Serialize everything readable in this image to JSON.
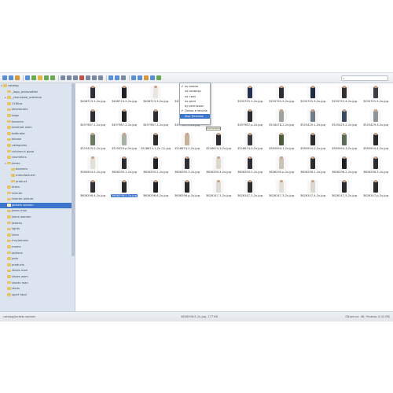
{
  "search": {
    "placeholder": ""
  },
  "toolbar": {
    "buttons": [
      "back",
      "forward",
      "up",
      "home",
      "reload",
      "folder",
      "upload",
      "download",
      "copy",
      "cut",
      "paste",
      "delete",
      "rename",
      "duplicate",
      "edit",
      "preview",
      "info",
      "resize",
      "view-icons",
      "view-list",
      "sort",
      "fullscreen",
      "settings"
    ]
  },
  "sidebar": {
    "items": [
      {
        "label": "catalog",
        "level": 0,
        "expanded": true
      },
      {
        "label": "_logo_proizvoditel",
        "level": 1
      },
      {
        "label": "_zhenskaia_odezhda",
        "level": 1,
        "collapsed": true
      },
      {
        "label": "3160sa",
        "level": 1
      },
      {
        "label": "aksessuars",
        "level": 1
      },
      {
        "label": "bags",
        "level": 1
      },
      {
        "label": "banners",
        "level": 1
      },
      {
        "label": "barefoot wom",
        "level": 1
      },
      {
        "label": "bathrobe",
        "level": 1
      },
      {
        "label": "blouse",
        "level": 1
      },
      {
        "label": "categories",
        "level": 1
      },
      {
        "label": "children's good",
        "level": 1
      },
      {
        "label": "cosmetics",
        "level": 1
      },
      {
        "label": "demo",
        "level": 1,
        "expanded": true
      },
      {
        "label": "banners",
        "level": 2
      },
      {
        "label": "manufacturer",
        "level": 2
      },
      {
        "label": "product",
        "level": 2
      },
      {
        "label": "dress",
        "level": 1
      },
      {
        "label": "interier",
        "level": 1
      },
      {
        "label": "interier picture",
        "level": 1
      },
      {
        "label": "Jackets women",
        "level": 1,
        "selected": true
      },
      {
        "label": "Jeans man",
        "level": 1
      },
      {
        "label": "jeans women",
        "level": 1
      },
      {
        "label": "Jewelry",
        "level": 1
      },
      {
        "label": "lights",
        "level": 1
      },
      {
        "label": "linen",
        "level": 1
      },
      {
        "label": "msyjamans",
        "level": 1
      },
      {
        "label": "moms",
        "level": 1
      },
      {
        "label": "options",
        "level": 1
      },
      {
        "label": "polo",
        "level": 1
      },
      {
        "label": "products",
        "level": 1
      },
      {
        "label": "shoes man",
        "level": 1
      },
      {
        "label": "shoes wom",
        "level": 1
      },
      {
        "label": "shorts man",
        "level": 1
      },
      {
        "label": "skirts",
        "level": 1
      },
      {
        "label": "sport food",
        "level": 1
      }
    ]
  },
  "grid": {
    "files": [
      "3408713-1-2x.jpg",
      "3408713-2-2x.jpg",
      "3408713-3-2x.jpg",
      "3408713-4-2x.jpg",
      "",
      "3499752-1-2x.jpg",
      "3499752-2-2x.jpg",
      "3499752-3-2x.jpg",
      "3499752-4-2x.jpg",
      "3499752-5-2x.jpg",
      "3497987-1-2x.jpg",
      "3497987-2-2x.jpg",
      "3497987-3-2x.jpg",
      "3497987-4-2x.jpg",
      "",
      "3497987-p-2x.jpg",
      "3516478-2-2x.jpg",
      "3525429-1-2x.jpg",
      "3525429-2-2x.jpg",
      "3525429-3-2x.jpg",
      "3525429-5-2x.jpg",
      "3525429-p-2x.jpg",
      "3528674-1-2x (1).jpg",
      "3528674-2-2x.jpg",
      "3528674-3-2x.jpg",
      "3528674-5-2x.jpg",
      "3584954-1-2x.jpg",
      "3584954-2-2x.jpg",
      "3584954-3-2x.jpg",
      "3584954-4-2x.jpg",
      "3584954-5-2x.jpg",
      "3606295-1-2x.jpg",
      "3606295-2-2x.jpg",
      "3606295-3-2x.jpg",
      "3606295-4-2x.jpg",
      "3606295-5-2x.jpg",
      "3606295-p-2x.jpg",
      "3606296-1-2x.jpg",
      "3606296-2-2x.jpg",
      "3606296-3-2x.jpg",
      "3606296-4-2x.jpg",
      "3606296-5-2x.jpg",
      "3606296-6-2x.jpg",
      "3606296-p-2x.jpg",
      "3626147-1-2x.jpg",
      "3626147-2-2x.jpg",
      "3626147-3-2x.jpg",
      "3626147-4-2x.jpg",
      "3626147-5-2x.jpg",
      "3626147-p-2x.jpg"
    ],
    "selected_index": 41,
    "colors": [
      "#2b2f38",
      "#1d1f24",
      "#e9e6df",
      "#2d3340",
      "#ffffff",
      "#243150",
      "#2a2c33",
      "#1f2a44",
      "#33302c",
      "#3a3d46",
      "#2e2f34",
      "#1f2024",
      "#2b2d30",
      "#1d1e22",
      "#ffffff",
      "#2a2b31",
      "#9ea39c",
      "#6f7c8a",
      "#3a4a5e",
      "#8e9599",
      "#6c7a62",
      "#a7b0a2",
      "#2c2b2a",
      "#c7b39a",
      "#2a2c30",
      "#383b3f",
      "#4d5a3e",
      "#2b2d31",
      "#5c6a55",
      "#27292d",
      "#e4e1d8",
      "#2a2b2f",
      "#202125",
      "#2e3035",
      "#ddd9cf",
      "#2d2e33",
      "#c9c3b6",
      "#2a2c2e",
      "#1e1f22",
      "#2c2d31",
      "#2f3136",
      "#26272b",
      "#1f2023",
      "#29292c",
      "#dddad3",
      "#2b2c2f",
      "#e2dfd7",
      "#dcd8cf",
      "#27292d",
      "#2a2b2f"
    ]
  },
  "dropdown": {
    "items": [
      {
        "label": "по имени",
        "checked": true
      },
      {
        "label": "по размеру"
      },
      {
        "label": "по типу"
      },
      {
        "label": "по дате"
      },
      {
        "label": "by permission"
      },
      {
        "label": "Папки в начале",
        "checked": true
      },
      {
        "label": "Alsо Treeview",
        "active": true
      }
    ]
  },
  "tooltip": {
    "text": "Сортировать"
  },
  "statusbar": {
    "path": "catalog/Jackets women",
    "file": "3606296-5-2x.jpg, 177 КБ",
    "info": "Объекты: 48, Размер: 6.20 МБ"
  }
}
